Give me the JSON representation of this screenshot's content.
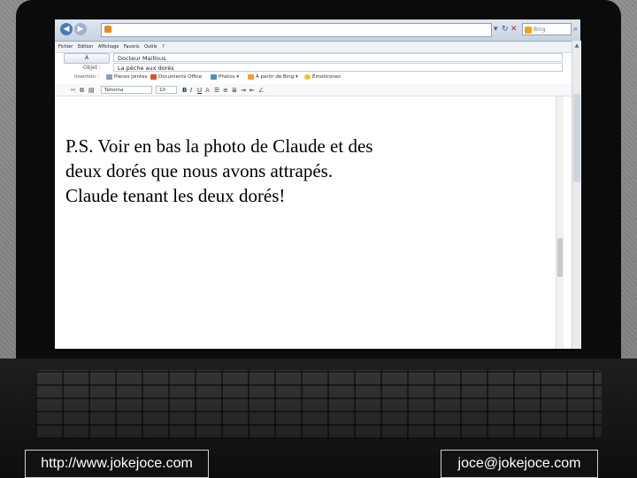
{
  "menu": [
    "Fichier",
    "Edition",
    "Affichage",
    "Favoris",
    "Outils",
    "?"
  ],
  "search": {
    "placeholder": "Bing"
  },
  "fields": {
    "to_button_label": "À",
    "to_value": "Docteur Maillous",
    "subject_label": "Objet :",
    "subject_value": "La pêche aux dorés"
  },
  "insertion": {
    "label": "Insertion :",
    "items": [
      "Pièces jointes",
      "Documents Office",
      "Photos ▾",
      "À partir de Bing ▾",
      "Émoticônes"
    ]
  },
  "format": {
    "font": "Tahoma",
    "size": "10"
  },
  "message": {
    "lines": [
      "P.S.  Voir en bas la photo de Claude et des",
      "deux dorés que nous avons attrapés.",
      "Claude tenant les deux dorés!"
    ]
  },
  "footer": {
    "url": "http://www.jokejoce.com",
    "email": "joce@jokejoce.com"
  },
  "colors": {
    "accent": "#4a79b8",
    "brand_orange": "#e48a1e"
  }
}
